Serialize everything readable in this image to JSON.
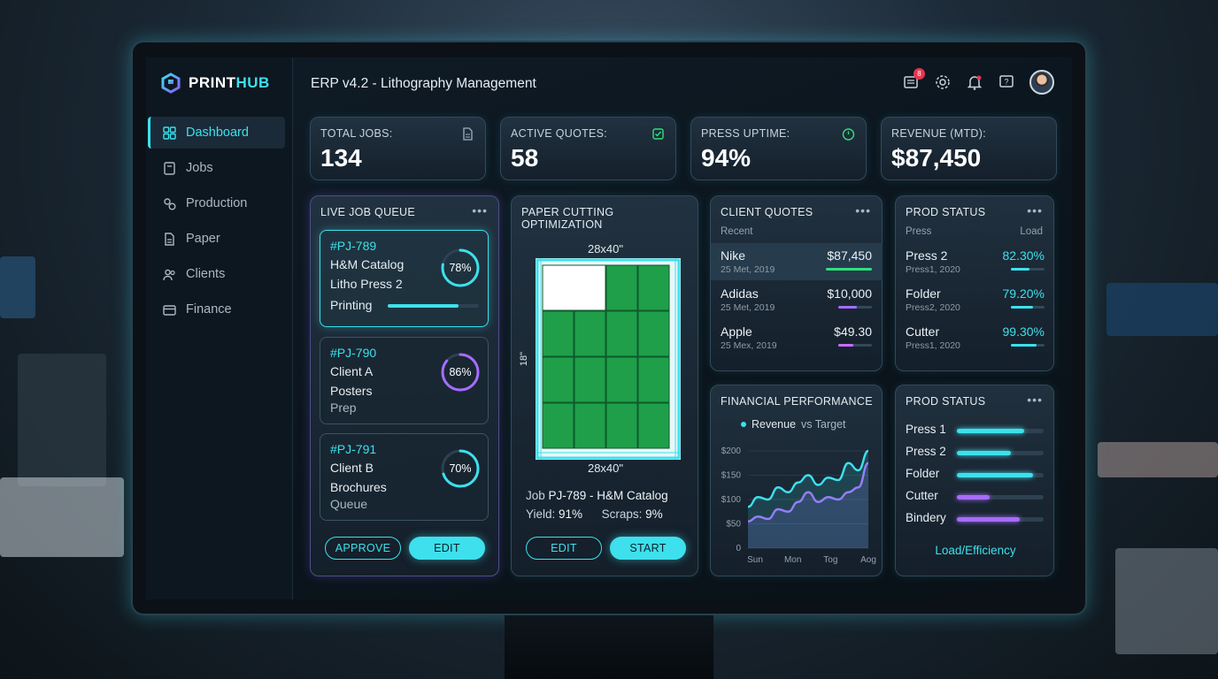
{
  "brand": {
    "name_a": "PRINT",
    "name_b": "HUB"
  },
  "app_title": "ERP v4.2 - Lithography Management",
  "notifications_badge": "8",
  "sidebar": {
    "items": [
      {
        "label": "Dashboard",
        "icon": "dashboard-icon",
        "active": true
      },
      {
        "label": "Jobs",
        "icon": "clipboard-icon",
        "active": false
      },
      {
        "label": "Production",
        "icon": "gears-icon",
        "active": false
      },
      {
        "label": "Paper",
        "icon": "document-icon",
        "active": false
      },
      {
        "label": "Clients",
        "icon": "users-icon",
        "active": false
      },
      {
        "label": "Finance",
        "icon": "card-icon",
        "active": false
      }
    ]
  },
  "kpis": [
    {
      "label": "TOTAL JOBS:",
      "value": "134",
      "icon": "document-icon"
    },
    {
      "label": "ACTIVE QUOTES:",
      "value": "58",
      "icon": "checkbox-icon"
    },
    {
      "label": "PRESS UPTIME:",
      "value": "94%",
      "icon": "timer-icon"
    },
    {
      "label": "REVENUE (MTD):",
      "value": "$87,450",
      "icon": ""
    }
  ],
  "job_queue": {
    "title": "LIVE JOB QUEUE",
    "jobs": [
      {
        "id": "#PJ-789",
        "line1": "H&M Catalog",
        "line2": "Litho Press 2",
        "status": "Printing",
        "pct": 78,
        "pct_label": "78%"
      },
      {
        "id": "#PJ-790",
        "line1": "Client A",
        "line2": "Posters",
        "status": "Prep",
        "pct": 86,
        "pct_label": "86%"
      },
      {
        "id": "#PJ-791",
        "line1": "Client B",
        "line2": "Brochures",
        "status": "Queue",
        "pct": 70,
        "pct_label": "70%"
      }
    ],
    "approve_label": "APPROVE",
    "edit_label": "EDIT"
  },
  "cutting": {
    "title": "PAPER CUTTING OPTIMIZATION",
    "top_dim": "28x40\"",
    "side_dim": "18\"",
    "bottom_dim": "28x40\"",
    "job_prefix": "Job ",
    "job_name": "PJ-789 - H&M Catalog",
    "yield_label": "Yield: ",
    "yield_value": "91%",
    "scraps_label": "Scraps: ",
    "scraps_value": "9%",
    "edit_label": "EDIT",
    "start_label": "START"
  },
  "client_quotes": {
    "title": "CLIENT QUOTES",
    "subheader": "Recent",
    "rows": [
      {
        "name": "Nike",
        "date": "25 Met, 2019",
        "value": "$87,450",
        "bar": 1.0,
        "bar_color": "#2ee07a"
      },
      {
        "name": "Adidas",
        "date": "25 Met, 2019",
        "value": "$10,000",
        "bar": 0.55,
        "bar_color": "#a66cff"
      },
      {
        "name": "Apple",
        "date": "25 Mex, 2019",
        "value": "$49.30",
        "bar": 0.45,
        "bar_color": "#c86cff"
      }
    ]
  },
  "prod_status_1": {
    "title": "PROD STATUS",
    "sub_left": "Press",
    "sub_right": "Load",
    "rows": [
      {
        "name": "Press 2",
        "date": "Press1, 2020",
        "value": "82.30%",
        "bar": 0.55
      },
      {
        "name": "Folder",
        "date": "Press2, 2020",
        "value": "79.20%",
        "bar": 0.65
      },
      {
        "name": "Cutter",
        "date": "Press1, 2020",
        "value": "99.30%",
        "bar": 0.75
      }
    ]
  },
  "financial": {
    "title": "FINANCIAL PERFORMANCE",
    "legend_a": "Revenue",
    "legend_b": "vs Target",
    "chart_data": {
      "type": "area",
      "categories": [
        "Sun",
        "Mon",
        "Tog",
        "Aog"
      ],
      "yticks": [
        "$200",
        "$150",
        "$100",
        "$50",
        "0"
      ],
      "ylim": [
        0,
        200
      ],
      "series": [
        {
          "name": "Revenue",
          "color": "#3de0ec",
          "values": [
            85,
            105,
            100,
            125,
            115,
            135,
            150,
            130,
            145,
            140,
            175,
            160,
            200
          ]
        },
        {
          "name": "vs Target",
          "color": "#a66cff",
          "values": [
            55,
            65,
            60,
            80,
            75,
            95,
            115,
            95,
            105,
            100,
            115,
            125,
            175
          ]
        }
      ]
    }
  },
  "prod_status_2": {
    "title": "PROD STATUS",
    "rows": [
      {
        "name": "Press 1",
        "bar": 0.78,
        "color": "#3de0ec"
      },
      {
        "name": "Press 2",
        "bar": 0.62,
        "color": "#3de0ec"
      },
      {
        "name": "Folder",
        "bar": 0.88,
        "color": "#3de0ec"
      },
      {
        "name": "Cutter",
        "bar": 0.38,
        "color": "#a66cff"
      },
      {
        "name": "Bindery",
        "bar": 0.72,
        "color": "#a66cff"
      }
    ],
    "footer_link": "Load/Efficiency"
  }
}
